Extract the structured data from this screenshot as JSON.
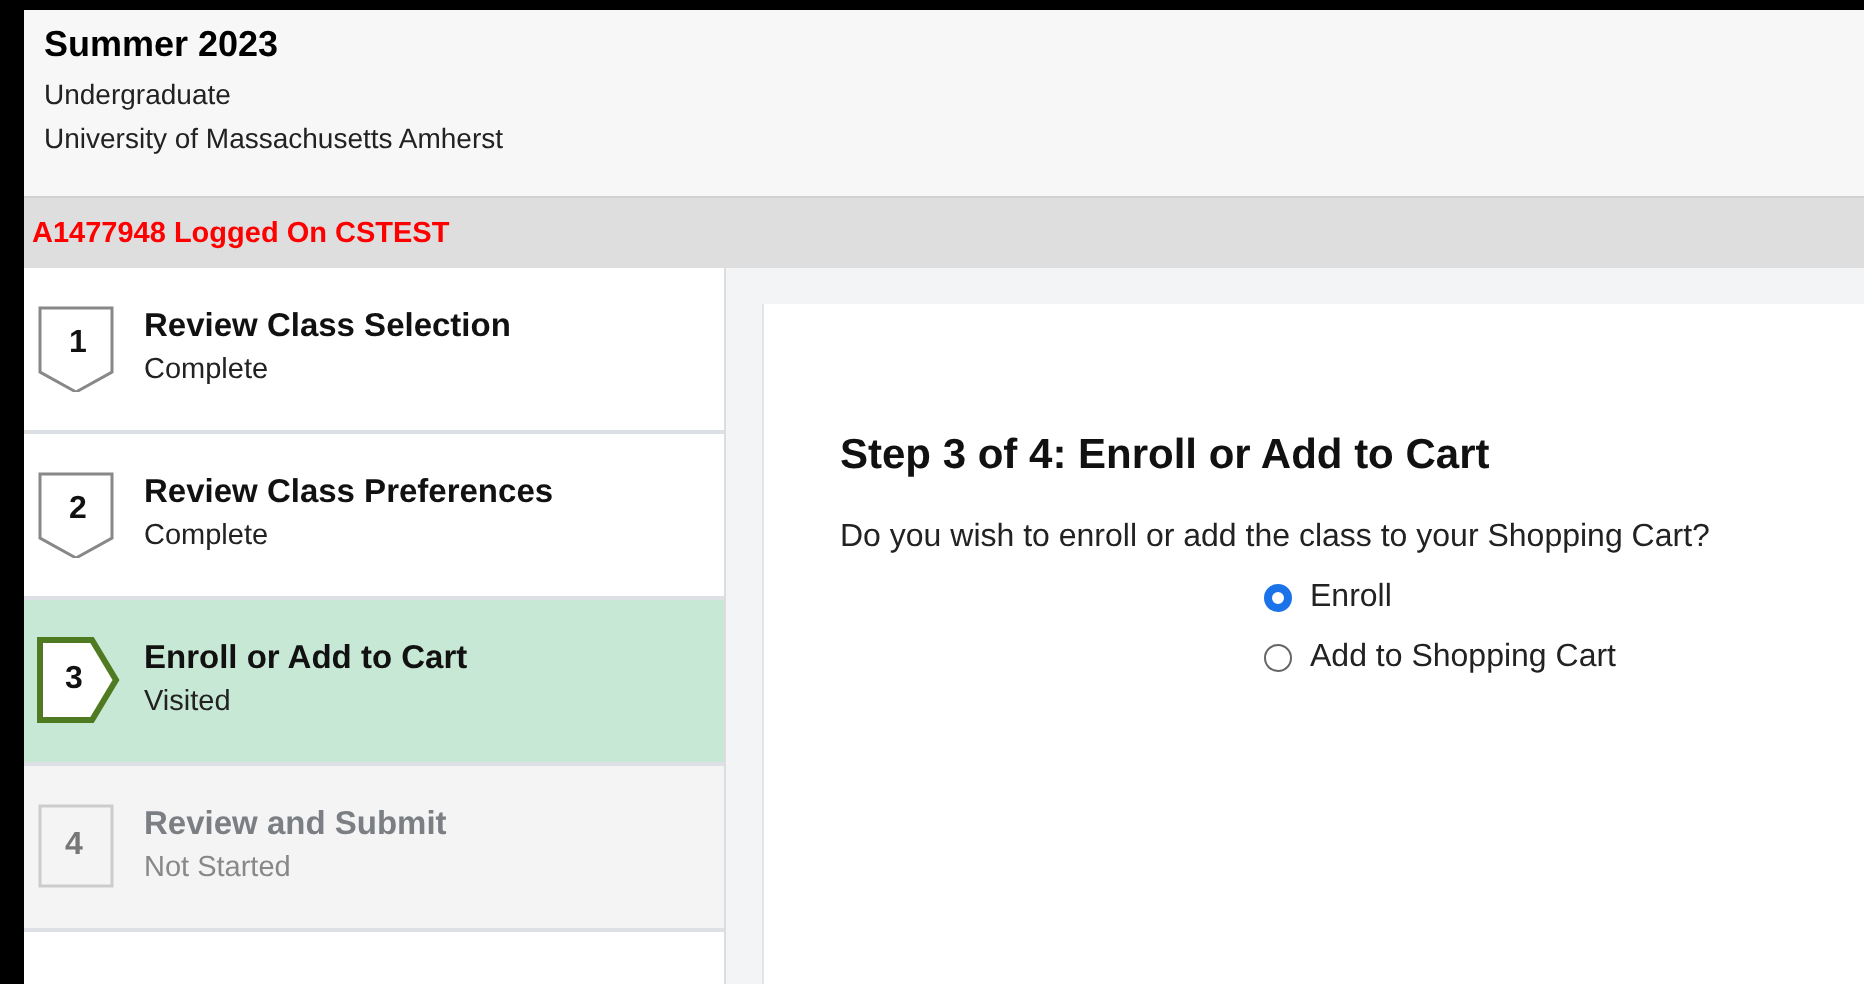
{
  "header": {
    "term": "Summer 2023",
    "career": "Undergraduate",
    "institution": "University of Massachusetts Amherst"
  },
  "login_banner": "A1477948 Logged On CSTEST",
  "steps": [
    {
      "number": "1",
      "title": "Review Class Selection",
      "status": "Complete",
      "kind": "complete",
      "selected": false
    },
    {
      "number": "2",
      "title": "Review Class Preferences",
      "status": "Complete",
      "kind": "complete",
      "selected": false
    },
    {
      "number": "3",
      "title": "Enroll or Add to Cart",
      "status": "Visited",
      "kind": "current",
      "selected": true
    },
    {
      "number": "4",
      "title": "Review and Submit",
      "status": "Not Started",
      "kind": "not_started",
      "selected": false
    }
  ],
  "content": {
    "heading": "Step 3 of 4: Enroll or Add to Cart",
    "question": "Do you wish to enroll or add the class to your Shopping Cart?",
    "options": [
      {
        "label": "Enroll",
        "selected": true
      },
      {
        "label": "Add to Shopping Cart",
        "selected": false
      }
    ]
  }
}
